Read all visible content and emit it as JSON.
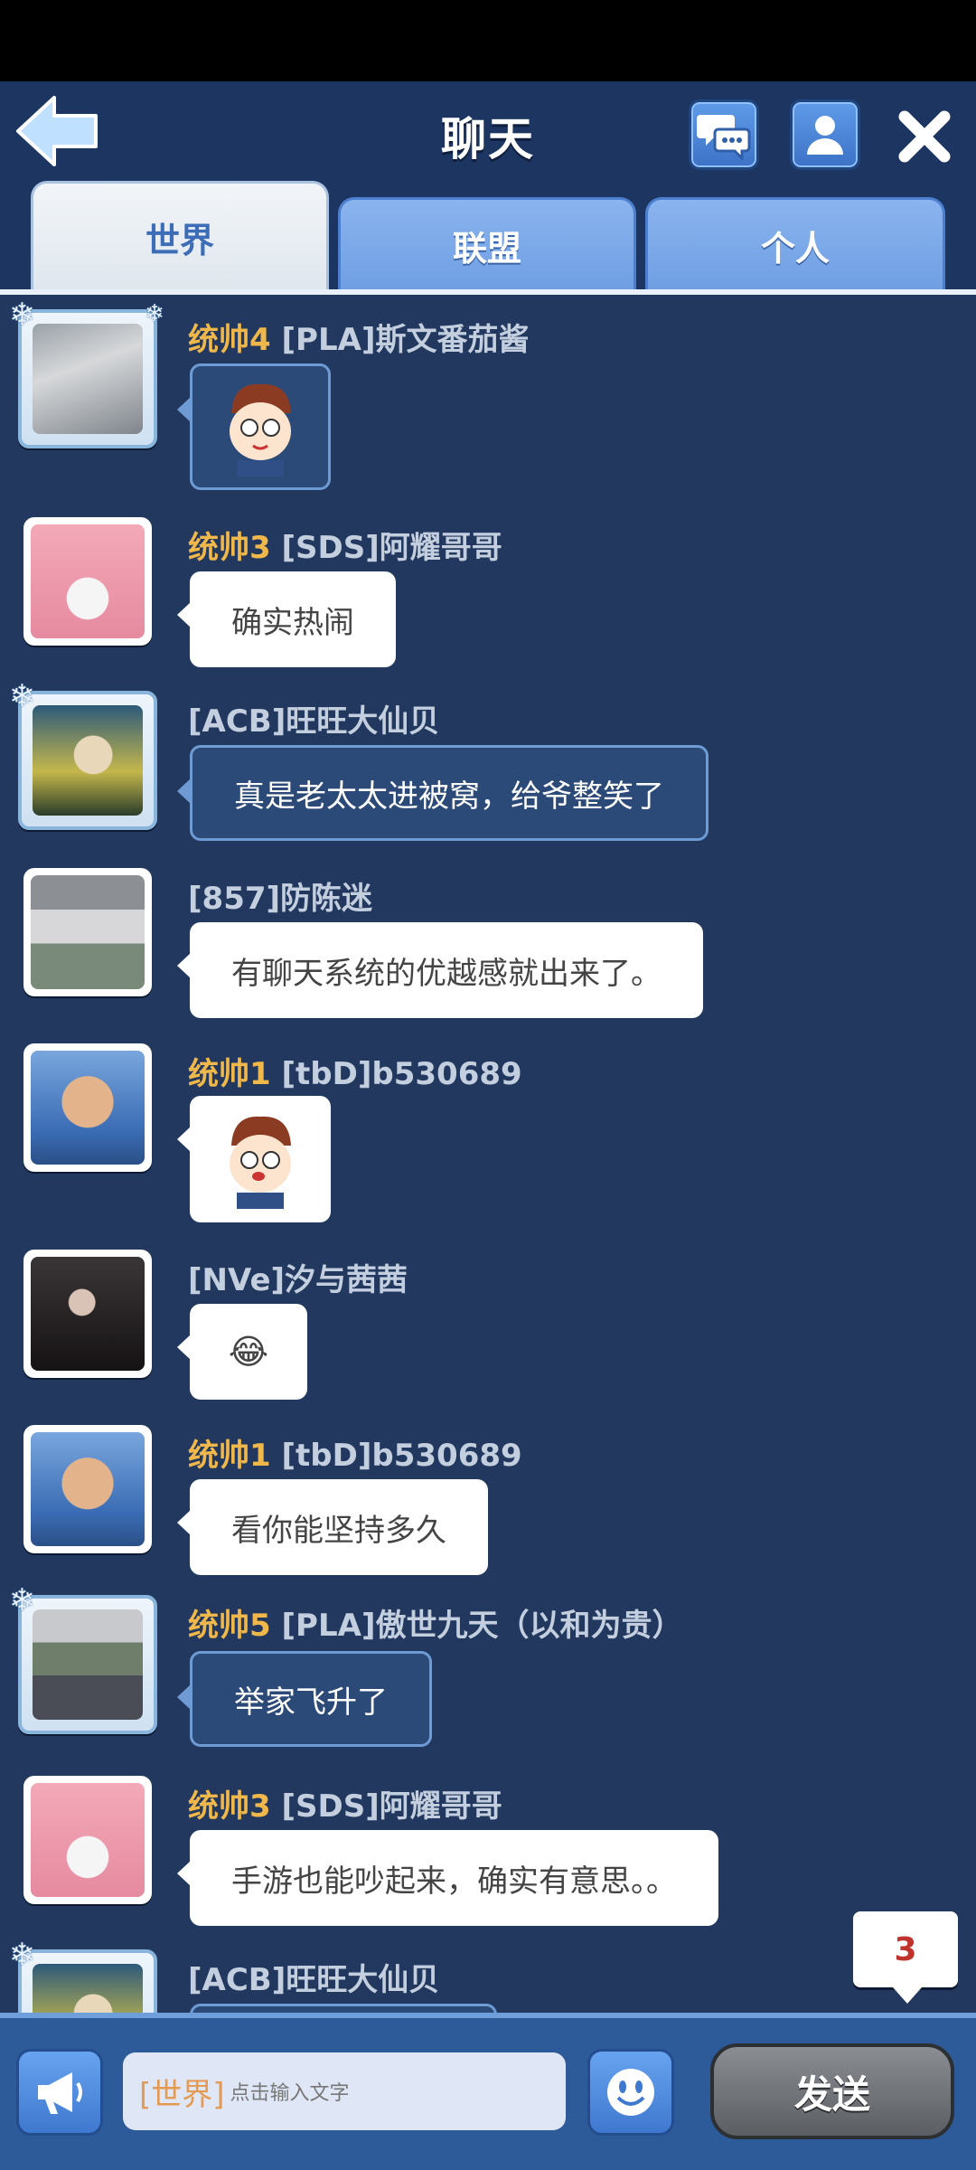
{
  "header": {
    "title": "聊天",
    "tabs": [
      {
        "label": "世界",
        "active": true
      },
      {
        "label": "联盟",
        "active": false
      },
      {
        "label": "个人",
        "active": false
      }
    ]
  },
  "messages": [
    {
      "rank": "统帅4",
      "name": "[PLA]斯文番茄酱",
      "type": "sticker",
      "text": "",
      "avatar": "portrait-girl",
      "frame": true
    },
    {
      "rank": "统帅3",
      "name": "[SDS]阿耀哥哥",
      "type": "text",
      "text": "确实热闹",
      "avatar": "pink-anime",
      "frame": false
    },
    {
      "rank": "",
      "name": "[ACB]旺旺大仙贝",
      "type": "text-dark",
      "text": "真是老太太进被窝，给爷整笑了",
      "avatar": "boy-yellow",
      "frame": true
    },
    {
      "rank": "",
      "name": "[857]防陈迷",
      "type": "text",
      "text": "有聊天系统的优越感就出来了。",
      "avatar": "gym-photo",
      "frame": false
    },
    {
      "rank": "统帅1",
      "name": "[tbD]b530689",
      "type": "sticker",
      "text": "",
      "avatar": "cartoon-hero",
      "frame": false
    },
    {
      "rank": "",
      "name": "[NVe]汐与茜茜",
      "type": "emoji",
      "text": "😂",
      "avatar": "dark-girl",
      "frame": false
    },
    {
      "rank": "统帅1",
      "name": "[tbD]b530689",
      "type": "text",
      "text": "看你能坚持多久",
      "avatar": "cartoon-hero",
      "frame": false
    },
    {
      "rank": "统帅5",
      "name": "[PLA]傲世九天（以和为贵）",
      "type": "text-dark",
      "text": "举家飞升了",
      "avatar": "street-photo",
      "frame": true
    },
    {
      "rank": "统帅3",
      "name": "[SDS]阿耀哥哥",
      "type": "text",
      "text": "手游也能吵起来，确实有意思。。",
      "avatar": "pink-anime",
      "frame": false
    },
    {
      "rank": "",
      "name": "[ACB]旺旺大仙贝",
      "type": "text-dark",
      "text": "",
      "avatar": "boy-yellow",
      "frame": true
    }
  ],
  "unread_badge": "3",
  "input": {
    "channel": "[世界]",
    "placeholder": "点击输入文字"
  },
  "send_label": "发送",
  "icons": {
    "back": "back-arrow-icon",
    "chat": "chat-bubbles-icon",
    "profile": "person-icon",
    "close": "close-icon",
    "horn": "megaphone-icon",
    "emoji": "smiley-icon"
  },
  "colors": {
    "background": "#22385f",
    "rank_gold": "#f0b84a",
    "name_gray": "#c3cfdf",
    "badge_red": "#c0322c"
  }
}
